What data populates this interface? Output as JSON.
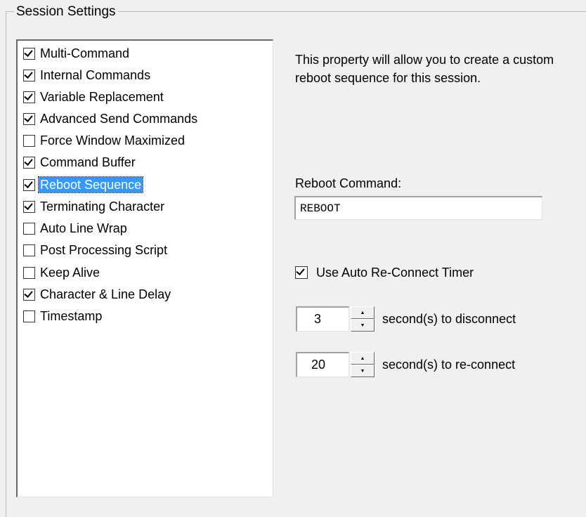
{
  "group": {
    "title": "Session Settings"
  },
  "list": {
    "items": [
      {
        "label": "Multi-Command",
        "checked": true
      },
      {
        "label": "Internal Commands",
        "checked": true
      },
      {
        "label": "Variable Replacement",
        "checked": true
      },
      {
        "label": "Advanced Send Commands",
        "checked": true
      },
      {
        "label": "Force Window Maximized",
        "checked": false
      },
      {
        "label": "Command Buffer",
        "checked": true
      },
      {
        "label": "Reboot Sequence",
        "checked": true,
        "selected": true
      },
      {
        "label": "Terminating Character",
        "checked": true
      },
      {
        "label": "Auto Line Wrap",
        "checked": false
      },
      {
        "label": "Post Processing Script",
        "checked": false
      },
      {
        "label": "Keep Alive",
        "checked": false
      },
      {
        "label": "Character & Line Delay",
        "checked": true
      },
      {
        "label": "Timestamp",
        "checked": false
      }
    ]
  },
  "details": {
    "description": "This property will allow you to create a custom reboot sequence for this session.",
    "reboot_label": "Reboot Command:",
    "reboot_value": "REBOOT",
    "auto_reconnect_label": "Use Auto Re-Connect Timer",
    "auto_reconnect_checked": true,
    "disconnect_value": "3",
    "disconnect_label": "second(s) to disconnect",
    "reconnect_value": "20",
    "reconnect_label": "second(s) to re-connect"
  },
  "icons": {
    "spin_up": "spin-up-arrow-icon",
    "spin_down": "spin-down-arrow-icon",
    "checkmark": "checkmark-icon"
  }
}
